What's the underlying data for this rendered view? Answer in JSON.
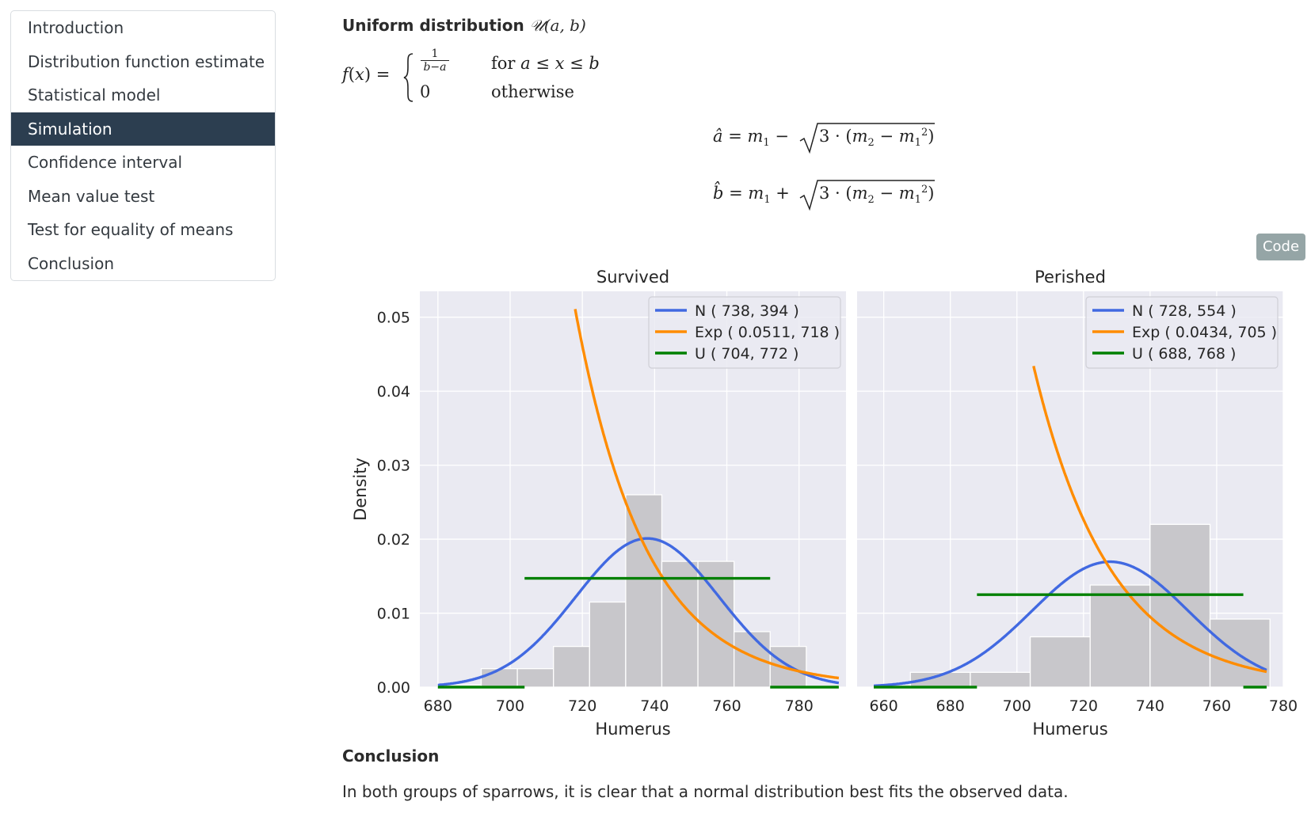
{
  "sidebar": {
    "items": [
      {
        "label": "Introduction",
        "active": false
      },
      {
        "label": "Distribution function estimate",
        "active": false
      },
      {
        "label": "Statistical model",
        "active": false
      },
      {
        "label": "Simulation",
        "active": true
      },
      {
        "label": "Confidence interval",
        "active": false
      },
      {
        "label": "Mean value test",
        "active": false
      },
      {
        "label": "Test for equality of means",
        "active": false
      },
      {
        "label": "Conclusion",
        "active": false
      }
    ]
  },
  "section": {
    "heading": "Uniform distribution",
    "heading_math": "𝒰(a, b)",
    "pdf_case1_cond": "for a ≤ x ≤ b",
    "pdf_case2_value": "0",
    "pdf_case2_cond": "otherwise"
  },
  "code_button": {
    "label": "Code"
  },
  "conclusion": {
    "title": "Conclusion",
    "text": "In both groups of sparrows, it is clear that a normal distribution best fits the observed data."
  },
  "colors": {
    "normal": "#4169e1",
    "exponential": "#ff8c00",
    "uniform": "#008000",
    "histogram": "#c8c7cb",
    "plot_bg": "#eaeaf2",
    "nav_active": "#2c3e50"
  },
  "chart_data": [
    {
      "type": "bar",
      "title": "Survived",
      "xlabel": "Humerus",
      "ylabel": "Density",
      "xticks": [
        680,
        700,
        720,
        740,
        760,
        780
      ],
      "yticks": [
        0.0,
        0.01,
        0.02,
        0.03,
        0.04,
        0.05
      ],
      "xlim": [
        675,
        793
      ],
      "ylim": [
        0,
        0.0535
      ],
      "grid": true,
      "legend_position": "top-right",
      "histogram": {
        "bin_edges": [
          682,
          692,
          702,
          712,
          722,
          732,
          742,
          752,
          762,
          772,
          782
        ],
        "densities": [
          0.0003,
          0.0025,
          0.0025,
          0.0055,
          0.0115,
          0.026,
          0.017,
          0.017,
          0.0075,
          0.0055
        ]
      },
      "series": [
        {
          "name": "N ( 738, 394 )",
          "dist": "normal",
          "params": {
            "mean": 738,
            "variance": 394
          },
          "x_range": [
            680,
            791
          ]
        },
        {
          "name": "Exp ( 0.0511, 718 )",
          "dist": "exponential",
          "params": {
            "lambda": 0.0511,
            "loc": 718
          },
          "x_range": [
            718,
            791
          ]
        },
        {
          "name": "U ( 704, 772 )",
          "dist": "uniform",
          "params": {
            "a": 704,
            "b": 772
          },
          "x_range": [
            680,
            791
          ]
        }
      ]
    },
    {
      "type": "bar",
      "title": "Perished",
      "xlabel": "Humerus",
      "ylabel": "",
      "xticks": [
        660,
        680,
        700,
        720,
        740,
        760,
        780
      ],
      "yticks": [
        0.0,
        0.01,
        0.02,
        0.03,
        0.04,
        0.05
      ],
      "xlim": [
        652,
        780
      ],
      "ylim": [
        0,
        0.0535
      ],
      "grid": true,
      "legend_position": "top-right",
      "histogram": {
        "bin_edges": [
          668,
          686,
          704,
          722,
          740,
          758,
          776
        ],
        "densities": [
          0.002,
          0.002,
          0.0068,
          0.0138,
          0.022,
          0.0092
        ]
      },
      "series": [
        {
          "name": "N ( 728, 554 )",
          "dist": "normal",
          "params": {
            "mean": 728,
            "variance": 554
          },
          "x_range": [
            657,
            775
          ]
        },
        {
          "name": "Exp ( 0.0434, 705 )",
          "dist": "exponential",
          "params": {
            "lambda": 0.0434,
            "loc": 705
          },
          "x_range": [
            705,
            775
          ]
        },
        {
          "name": "U ( 688, 768 )",
          "dist": "uniform",
          "params": {
            "a": 688,
            "b": 768
          },
          "x_range": [
            657,
            775
          ]
        }
      ]
    }
  ]
}
